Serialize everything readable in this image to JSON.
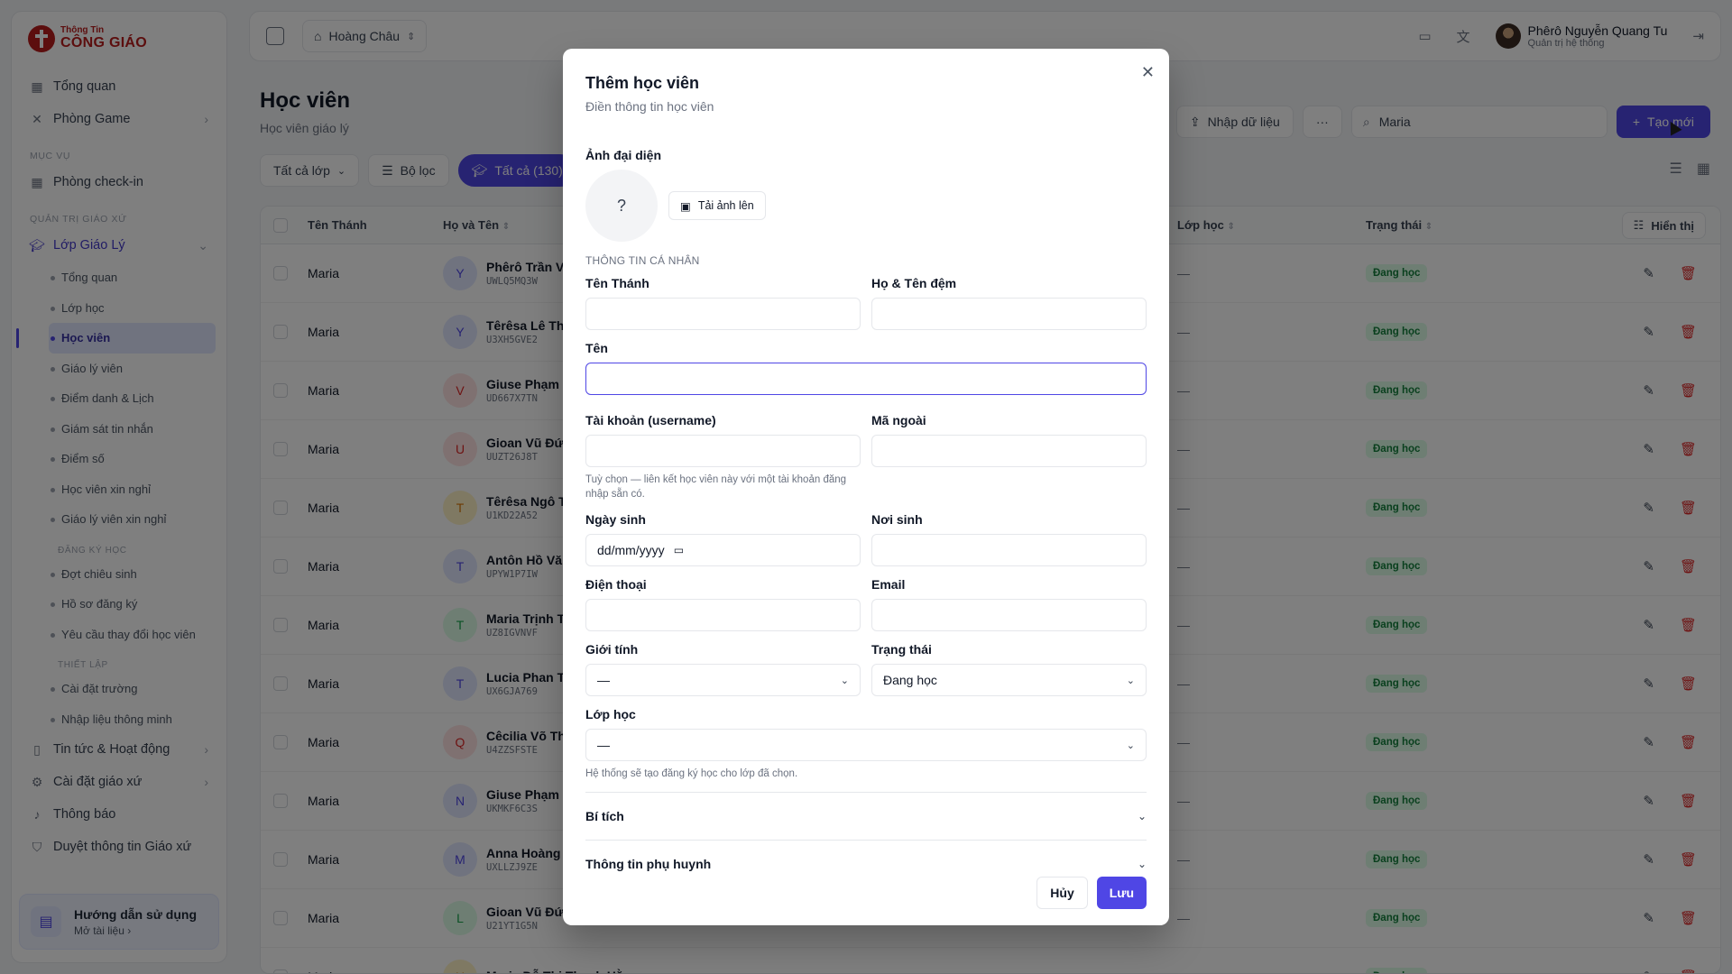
{
  "brand": {
    "line1": "Thông Tin",
    "line2": "CÔNG GIÁO",
    "color": "#b91c1c"
  },
  "sidebar": {
    "top_items": [
      {
        "label": "Tổng quan",
        "icon": "grid-icon"
      },
      {
        "label": "Phòng Game",
        "icon": "gamepad-icon",
        "has_chevron": true
      }
    ],
    "section_muc_vu": "MỤC VỤ",
    "muc_vu_items": [
      {
        "label": "Phòng check-in",
        "icon": "qr-icon"
      }
    ],
    "section_quan_tri": "QUẢN TRỊ GIÁO XỨ",
    "lop_giao_ly": "Lớp Giáo Lý",
    "sub_items": [
      "Tổng quan",
      "Lớp học",
      "Học viên",
      "Giáo lý viên",
      "Điểm danh & Lịch",
      "Giám sát tin nhắn",
      "Điểm số",
      "Học viên xin nghỉ",
      "Giáo lý viên xin nghỉ"
    ],
    "sub_section_dang_ky": "ĐĂNG KÝ HỌC",
    "dang_ky_items": [
      "Đợt chiêu sinh",
      "Hồ sơ đăng ký",
      "Yêu cầu thay đổi học viên"
    ],
    "sub_section_thiet_lap": "THIẾT LẬP",
    "thiet_lap_items": [
      "Cài đặt trường",
      "Nhập liệu thông minh"
    ],
    "bottom_items": [
      {
        "label": "Tin tức & Hoạt động",
        "has_chevron": true
      },
      {
        "label": "Cài đặt giáo xứ",
        "has_chevron": true
      },
      {
        "label": "Thông báo"
      },
      {
        "label": "Duyệt thông tin Giáo xứ"
      }
    ],
    "help": {
      "title": "Hướng dẫn sử dụng",
      "link": "Mở tài liệu ›"
    }
  },
  "topbar": {
    "parish": "Hoàng Châu",
    "user_name": "Phêrô Nguyễn Quang Tu",
    "user_role": "Quản trị hệ thống"
  },
  "page": {
    "title": "Học viên",
    "subtitle": "Học viên giáo lý",
    "import_label": "Nhập dữ liệu",
    "search_value": "Maria",
    "create_label": "Tạo mới",
    "filter_class": "Tất cả lớp",
    "filter_label": "Bộ lọc",
    "all_chip": "Tất cả (130)"
  },
  "table": {
    "headers": {
      "saint": "Tên Thánh",
      "name": "Họ và Tên",
      "class": "Lớp học",
      "status": "Trạng thái",
      "display": "Hiển thị"
    },
    "rows": [
      {
        "saint": "Maria",
        "initial": "Y",
        "name": "Phêrô Trần V",
        "code": "UWLQ5MQ3W",
        "cls": "—",
        "status": "Đang học",
        "av_bg": "#e0e7ff",
        "av_fg": "#4f46e5"
      },
      {
        "saint": "Maria",
        "initial": "Y",
        "name": "Têrêsa Lê Thị",
        "code": "U3XH5GVE2",
        "cls": "—",
        "status": "Đang học",
        "av_bg": "#e0e7ff",
        "av_fg": "#4f46e5"
      },
      {
        "saint": "Maria",
        "initial": "V",
        "name": "Giuse Phạm",
        "code": "UD667X7TN",
        "cls": "—",
        "status": "Đang học",
        "av_bg": "#fee2e2",
        "av_fg": "#dc2626"
      },
      {
        "saint": "Maria",
        "initial": "U",
        "name": "Gioan Vũ Đứ",
        "code": "UUZT26J8T",
        "cls": "—",
        "status": "Đang học",
        "av_bg": "#fee2e2",
        "av_fg": "#dc2626"
      },
      {
        "saint": "Maria",
        "initial": "T",
        "name": "Têrêsa Ngô T",
        "code": "U1KD22A52",
        "cls": "—",
        "status": "Đang học",
        "av_bg": "#fef3c7",
        "av_fg": "#d97706"
      },
      {
        "saint": "Maria",
        "initial": "T",
        "name": "Antôn Hồ Vă",
        "code": "UPYW1P7IW",
        "cls": "—",
        "status": "Đang học",
        "av_bg": "#e0e7ff",
        "av_fg": "#4f46e5"
      },
      {
        "saint": "Maria",
        "initial": "T",
        "name": "Maria Trịnh T",
        "code": "UZ8IGVNVF",
        "cls": "—",
        "status": "Đang học",
        "av_bg": "#dcfce7",
        "av_fg": "#16a34a"
      },
      {
        "saint": "Maria",
        "initial": "T",
        "name": "Lucia Phan Ti",
        "code": "UX6GJA769",
        "cls": "—",
        "status": "Đang học",
        "av_bg": "#e0e7ff",
        "av_fg": "#4f46e5"
      },
      {
        "saint": "Maria",
        "initial": "Q",
        "name": "Cêcilia Võ Th",
        "code": "U4ZZSFSTE",
        "cls": "—",
        "status": "Đang học",
        "av_bg": "#fee2e2",
        "av_fg": "#dc2626"
      },
      {
        "saint": "Maria",
        "initial": "N",
        "name": "Giuse Phạm",
        "code": "UKMKF6C3S",
        "cls": "—",
        "status": "Đang học",
        "av_bg": "#e0e7ff",
        "av_fg": "#4f46e5"
      },
      {
        "saint": "Maria",
        "initial": "M",
        "name": "Anna Hoàng",
        "code": "UXLLZJ9ZE",
        "cls": "—",
        "status": "Đang học",
        "av_bg": "#e0e7ff",
        "av_fg": "#4f46e5"
      },
      {
        "saint": "Maria",
        "initial": "L",
        "name": "Gioan Vũ Đứ",
        "code": "U21YT1G5N",
        "cls": "—",
        "status": "Đang học",
        "av_bg": "#dcfce7",
        "av_fg": "#16a34a"
      },
      {
        "saint": "Maria",
        "initial": "H",
        "name": "Maria Đỗ Thị Thanh Hằng",
        "code": "",
        "cls": "—",
        "status": "Đang học",
        "av_bg": "#fef3c7",
        "av_fg": "#d97706"
      }
    ]
  },
  "modal": {
    "title": "Thêm học viên",
    "subtitle": "Điền thông tin học viên",
    "avatar_label": "Ảnh đại diện",
    "avatar_placeholder": "?",
    "upload_label": "Tải ảnh lên",
    "section_personal": "THÔNG TIN CÁ NHÂN",
    "saint_name_label": "Tên Thánh",
    "middle_name_label": "Họ & Tên đệm",
    "first_name_label": "Tên",
    "username_label": "Tài khoản (username)",
    "external_code_label": "Mã ngoài",
    "username_hint": "Tuỳ chọn — liên kết học viên này với một tài khoản đăng nhập sẵn có.",
    "dob_label": "Ngày sinh",
    "dob_placeholder": "dd/mm/yyyy",
    "birthplace_label": "Nơi sinh",
    "phone_label": "Điện thoại",
    "email_label": "Email",
    "gender_label": "Giới tính",
    "gender_value": "—",
    "status_label": "Trạng thái",
    "status_value": "Đang học",
    "class_label": "Lớp học",
    "class_value": "—",
    "class_hint": "Hệ thống sẽ tạo đăng ký học cho lớp đã chọn.",
    "sacraments_label": "Bí tích",
    "parents_label": "Thông tin phụ huynh",
    "cancel_label": "Hủy",
    "save_label": "Lưu"
  },
  "colors": {
    "accent": "#4f46e5",
    "status_green": "#15803d",
    "danger": "#dc2626"
  }
}
